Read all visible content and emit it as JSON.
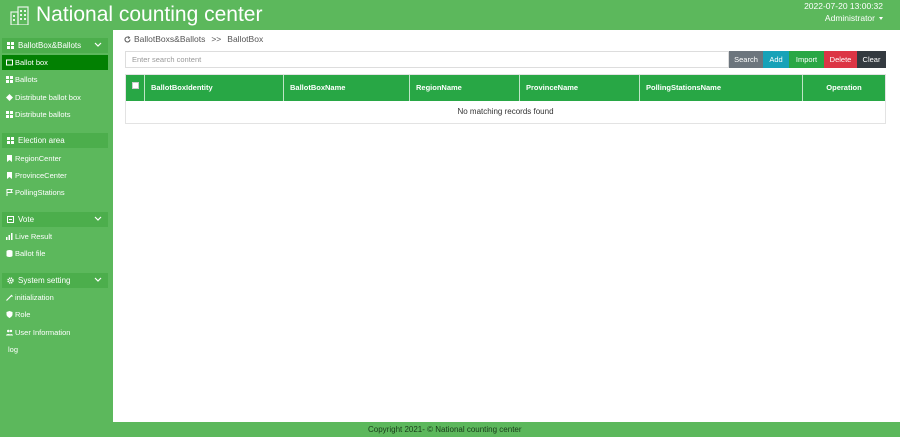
{
  "header": {
    "title": "National counting center",
    "datetime": "2022-07-20 13:00:32",
    "user": "Administrator"
  },
  "sidebar": {
    "groups": [
      {
        "label": "BallotBox&Ballots",
        "items": [
          {
            "label": "Ballot box",
            "icon": "ballot-box-icon",
            "active": true
          },
          {
            "label": "Ballots",
            "icon": "grid-icon"
          },
          {
            "label": "Distribute ballot box",
            "icon": "gem-icon"
          },
          {
            "label": "Distribute ballots",
            "icon": "grid-icon"
          }
        ]
      },
      {
        "label": "Election area",
        "items": [
          {
            "label": "RegionCenter",
            "icon": "bookmark-icon"
          },
          {
            "label": "ProvinceCenter",
            "icon": "bookmark-icon"
          },
          {
            "label": "PollingStations",
            "icon": "flag-icon"
          }
        ]
      },
      {
        "label": "Vote",
        "items": [
          {
            "label": "Live Result",
            "icon": "bar-chart-icon"
          },
          {
            "label": "Ballot file",
            "icon": "database-icon"
          }
        ]
      },
      {
        "label": "System setting",
        "items": [
          {
            "label": "initialization",
            "icon": "wrench-icon"
          },
          {
            "label": "Role",
            "icon": "shield-icon"
          },
          {
            "label": "User Information",
            "icon": "users-icon"
          },
          {
            "label": "log",
            "icon": ""
          }
        ]
      }
    ]
  },
  "breadcrumb": {
    "parent": "BallotBoxs&Ballots",
    "separator": ">>",
    "current": "BallotBox"
  },
  "toolbar": {
    "search_placeholder": "Enter search content",
    "search_label": "Search",
    "add_label": "Add",
    "import_label": "Import",
    "delete_label": "Delete",
    "clear_label": "Clear"
  },
  "table": {
    "columns": [
      "BallotBoxIdentity",
      "BallotBoxName",
      "RegionName",
      "ProvinceName",
      "PollingStationsName",
      "Operation"
    ],
    "empty_message": "No matching records found"
  },
  "footer": {
    "copyright": "Copyright 2021- © National counting center"
  },
  "colors": {
    "brand_green": "#5cb85c",
    "header_green": "#28a745",
    "active_item": "#028002",
    "add": "#17a2b8",
    "delete": "#dc3545",
    "clear": "#343a40",
    "search": "#6c757d"
  }
}
